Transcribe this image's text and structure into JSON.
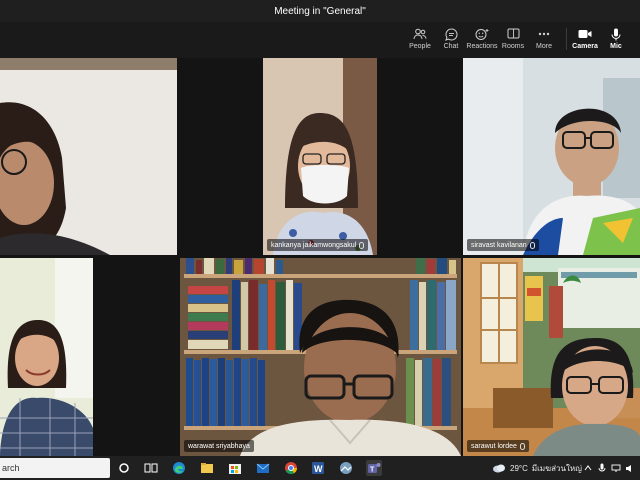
{
  "window": {
    "title": "Meeting in \"General\""
  },
  "toolbar": {
    "people": "People",
    "chat": "Chat",
    "reactions": "Reactions",
    "rooms": "Rooms",
    "more": "More",
    "camera": "Camera",
    "mic": "Mic"
  },
  "participants": {
    "p1": "kankanya jaikamwongsakul",
    "p2": "siravast kavilanan",
    "p3": "warawat sriyabhaya",
    "p4": "sarawut lordee"
  },
  "taskbar": {
    "search_text": "arch",
    "weather": "29°C",
    "location": "มีเมฆส่วนใหญ่"
  },
  "colors": {
    "teams_purple": "#6264a7",
    "titlebar": "#1f1f1f",
    "taskbar": "#202020"
  }
}
